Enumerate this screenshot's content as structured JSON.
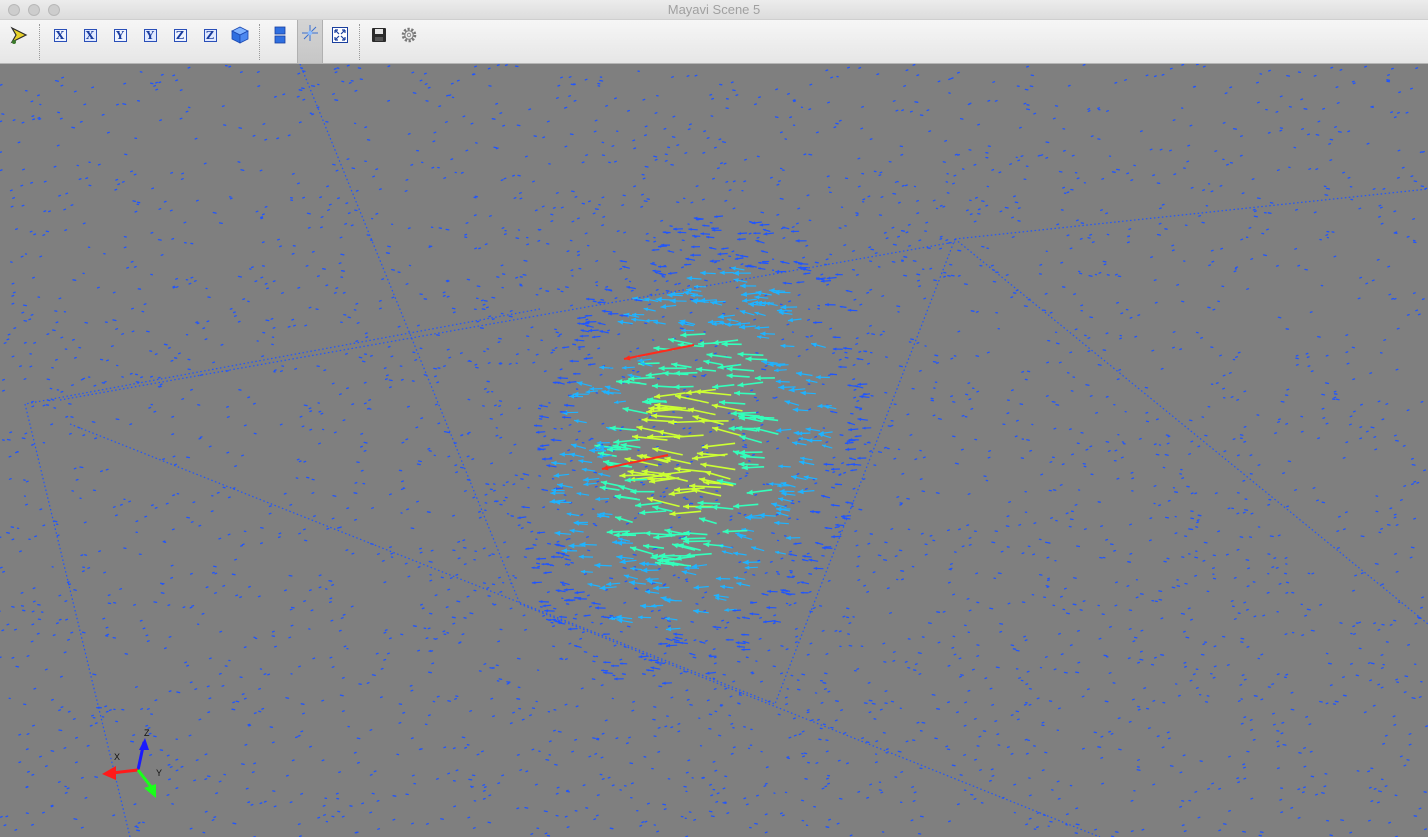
{
  "window": {
    "title": "Mayavi Scene 5"
  },
  "toolbar": {
    "buttons": [
      {
        "name": "pipeline-button",
        "icon": "mayavi-pipeline-icon"
      },
      {
        "name": "view-x-plus-button",
        "icon": "x-axis-view-icon",
        "label": "X"
      },
      {
        "name": "view-x-minus-button",
        "icon": "x-axis-view-icon",
        "label": "X"
      },
      {
        "name": "view-y-plus-button",
        "icon": "y-axis-view-icon",
        "label": "Y"
      },
      {
        "name": "view-y-minus-button",
        "icon": "y-axis-view-icon",
        "label": "Y"
      },
      {
        "name": "view-z-plus-button",
        "icon": "z-axis-view-icon",
        "label": "Z"
      },
      {
        "name": "view-z-minus-button",
        "icon": "z-axis-view-icon",
        "label": "Z"
      },
      {
        "name": "isometric-view-button",
        "icon": "cube-icon"
      },
      {
        "name": "parallel-projection-button",
        "icon": "parallel-projection-icon"
      },
      {
        "name": "toggle-axes-button",
        "icon": "axes-icon",
        "active": true
      },
      {
        "name": "full-screen-button",
        "icon": "fullscreen-icon"
      },
      {
        "name": "save-button",
        "icon": "save-icon"
      },
      {
        "name": "configure-button",
        "icon": "gear-icon"
      }
    ]
  },
  "orientation_axes": {
    "x_label": "X",
    "y_label": "Y",
    "z_label": "Z"
  },
  "colors": {
    "background": "#7f7f7f",
    "far_arrows": "#1f55ff",
    "mid_arrows": "#1fb3ff",
    "near_arrows": "#33ffbb",
    "strong_arrows": "#ccff33",
    "max_arrows": "#ff2a1a"
  }
}
